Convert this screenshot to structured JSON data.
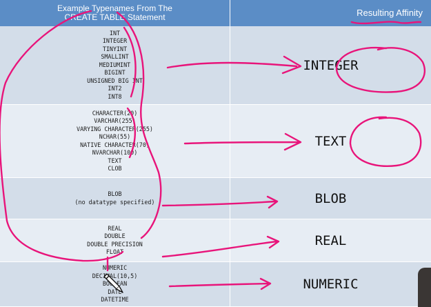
{
  "header": {
    "left_title_line1": "Example Typenames From The",
    "left_title_line2": "CREATE TABLE Statement",
    "right_title": "Resulting Affinity"
  },
  "rows": [
    {
      "typenames": [
        "INT",
        "INTEGER",
        "TINYINT",
        "SMALLINT",
        "MEDIUMINT",
        "BIGINT",
        "UNSIGNED BIG INT",
        "INT2",
        "INT8"
      ],
      "affinity": "INTEGER"
    },
    {
      "typenames": [
        "CHARACTER(20)",
        "VARCHAR(255)",
        "VARYING CHARACTER(255)",
        "NCHAR(55)",
        "NATIVE CHARACTER(70)",
        "NVARCHAR(100)",
        "TEXT",
        "CLOB"
      ],
      "affinity": "TEXT"
    },
    {
      "typenames": [
        "BLOB",
        "(no datatype specified)"
      ],
      "affinity": "BLOB"
    },
    {
      "typenames": [
        "REAL",
        "DOUBLE",
        "DOUBLE PRECISION",
        "FLOAT"
      ],
      "affinity": "REAL"
    },
    {
      "typenames": [
        "NUMERIC",
        "DECIMAL(10,5)",
        "BOOLEAN",
        "DATE",
        "DATETIME"
      ],
      "affinity": "NUMERIC"
    }
  ],
  "colors": {
    "header_bg": "#5b8dc6",
    "row_odd": "#d3dde9",
    "row_even": "#e7edf4",
    "annotation_ink": "#e8147a"
  },
  "icons": {
    "cursor": "pencil-cursor-icon"
  }
}
